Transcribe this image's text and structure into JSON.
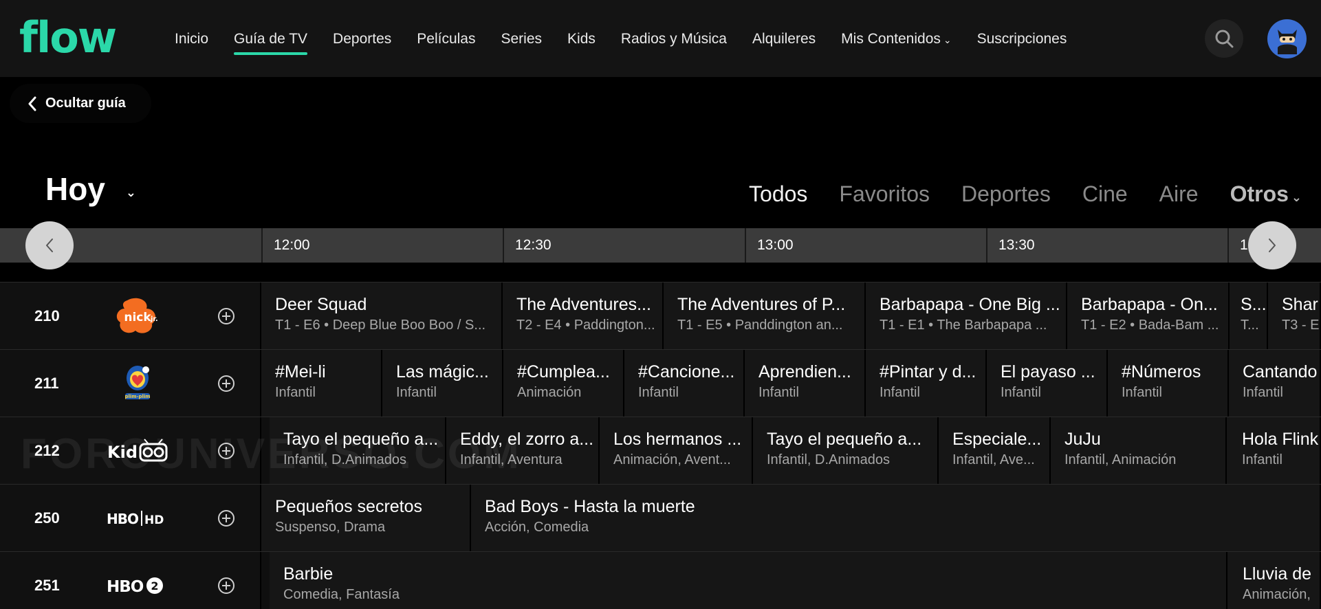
{
  "header": {
    "logo": "flow",
    "nav": [
      {
        "label": "Inicio"
      },
      {
        "label": "Guía de TV",
        "active": true
      },
      {
        "label": "Deportes"
      },
      {
        "label": "Películas"
      },
      {
        "label": "Series"
      },
      {
        "label": "Kids"
      },
      {
        "label": "Radios y Música"
      },
      {
        "label": "Alquileres"
      },
      {
        "label": "Mis Contenidos",
        "dropdown": true
      },
      {
        "label": "Suscripciones"
      }
    ],
    "search_icon": "search-icon",
    "avatar_icon": "ninja-avatar-icon",
    "accent": "#2bd8a9"
  },
  "hide_guide": {
    "label": "Ocultar guía",
    "icon": "chevron-left-icon"
  },
  "day": {
    "label": "Hoy",
    "icon": "chevron-down-icon"
  },
  "filters": [
    {
      "label": "Todos",
      "active": true
    },
    {
      "label": "Favoritos"
    },
    {
      "label": "Deportes"
    },
    {
      "label": "Cine"
    },
    {
      "label": "Aire"
    },
    {
      "label": "Otros",
      "dropdown": true
    }
  ],
  "timeline": {
    "ticks": [
      "12:00",
      "12:30",
      "13:00",
      "13:30",
      "1"
    ]
  },
  "watermark": "FOROUNIVERSO.COM",
  "channels": [
    {
      "number": "210",
      "logo": "nick-jr-logo",
      "programs": [
        {
          "title": "Deer Squad",
          "sub": "T1 - E6 • Deep Blue Boo Boo / S..."
        },
        {
          "title": "The Adventures...",
          "sub": "T2 - E4 • Paddington..."
        },
        {
          "title": "The Adventures of P...",
          "sub": "T1 - E5 • Panddington an..."
        },
        {
          "title": "Barbapapa - One Big ...",
          "sub": "T1 - E1 • The Barbapapa ..."
        },
        {
          "title": "Barbapapa - On...",
          "sub": "T1 - E2 • Bada-Bam ..."
        },
        {
          "title": "S...",
          "sub": "T..."
        },
        {
          "title": "Shar",
          "sub": "T3 - E"
        }
      ]
    },
    {
      "number": "211",
      "logo": "plim-plim-logo",
      "programs": [
        {
          "title": "#Mei-li",
          "sub": "Infantil"
        },
        {
          "title": "Las mágic...",
          "sub": "Infantil"
        },
        {
          "title": "#Cumplea...",
          "sub": "Animación"
        },
        {
          "title": "#Cancione...",
          "sub": "Infantil"
        },
        {
          "title": "Aprendien...",
          "sub": "Infantil"
        },
        {
          "title": "#Pintar y d...",
          "sub": "Infantil"
        },
        {
          "title": "El payaso ...",
          "sub": "Infantil"
        },
        {
          "title": "#Números",
          "sub": "Infantil"
        },
        {
          "title": "Cantando",
          "sub": "Infantil"
        }
      ]
    },
    {
      "number": "212",
      "logo": "kidoo-logo",
      "programs": [
        {
          "title": "Tayo el pequeño a...",
          "sub": "Infantil, D.Animados"
        },
        {
          "title": "Eddy, el zorro a...",
          "sub": "Infantil, Aventura"
        },
        {
          "title": "Los hermanos ...",
          "sub": "Animación, Avent..."
        },
        {
          "title": "Tayo el pequeño a...",
          "sub": "Infantil, D.Animados"
        },
        {
          "title": "Especiale...",
          "sub": "Infantil, Ave..."
        },
        {
          "title": "JuJu",
          "sub": "Infantil, Animación"
        },
        {
          "title": "Hola Flink",
          "sub": "Infantil"
        }
      ]
    },
    {
      "number": "250",
      "logo": "hbo-hd-logo",
      "programs": [
        {
          "title": "Pequeños secretos",
          "sub": "Suspenso, Drama"
        },
        {
          "title": "Bad Boys - Hasta la muerte",
          "sub": "Acción, Comedia"
        }
      ]
    },
    {
      "number": "251",
      "logo": "hbo-2-logo",
      "programs": [
        {
          "title": "Barbie",
          "sub": "Comedia, Fantasía"
        },
        {
          "title": "Lluvia de",
          "sub": "Animación,"
        }
      ]
    }
  ]
}
